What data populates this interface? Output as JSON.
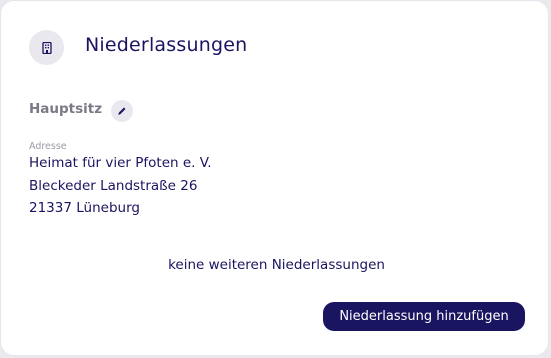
{
  "header": {
    "title": "Niederlassungen",
    "icon": "building-icon"
  },
  "main_office": {
    "label": "Hauptsitz",
    "edit_icon": "pencil-icon",
    "address_label": "Adresse",
    "address_lines": [
      "Heimat für vier Pfoten e. V.",
      "Bleckeder Landstraße 26",
      "21337 Lüneburg"
    ]
  },
  "branches": {
    "empty_text": "keine weiteren Niederlassungen",
    "add_button_label": "Niederlassung hinzufügen"
  },
  "colors": {
    "primary": "#1a1561",
    "muted_text": "#7a7a86",
    "icon_bg": "#e8e8ee"
  }
}
